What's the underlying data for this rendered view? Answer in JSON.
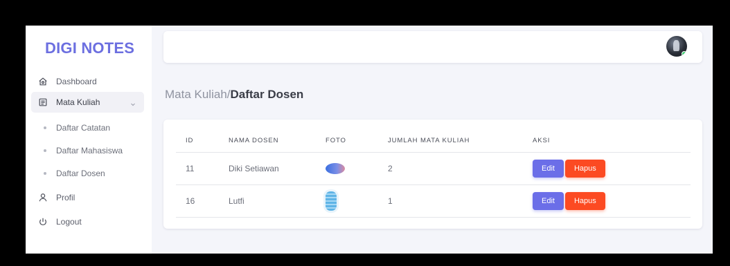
{
  "brand": "DIGI NOTES",
  "sidebar": {
    "items": [
      {
        "label": "Dashboard",
        "icon": "home-icon"
      },
      {
        "label": "Mata Kuliah",
        "icon": "list-icon"
      },
      {
        "label": "Profil",
        "icon": "user-icon"
      },
      {
        "label": "Logout",
        "icon": "power-icon"
      }
    ],
    "sub_items": [
      {
        "label": "Daftar Catatan"
      },
      {
        "label": "Daftar Mahasiswa"
      },
      {
        "label": "Daftar Dosen"
      }
    ]
  },
  "breadcrumb": {
    "parent": "Mata Kuliah/",
    "current": "Daftar Dosen"
  },
  "table": {
    "headers": [
      "ID",
      "NAMA DOSEN",
      "FOTO",
      "JUMLAH MATA KULIAH",
      "AKSI"
    ],
    "rows": [
      {
        "id": "11",
        "nama": "Diki Setiawan",
        "jumlah": "2"
      },
      {
        "id": "16",
        "nama": "Lutfi",
        "jumlah": "1"
      }
    ],
    "edit_label": "Edit",
    "hapus_label": "Hapus"
  },
  "colors": {
    "brand": "#6c6fe0",
    "edit_button": "#6b6ee8",
    "delete_button": "#fc4a22",
    "background": "#f4f5fa"
  }
}
